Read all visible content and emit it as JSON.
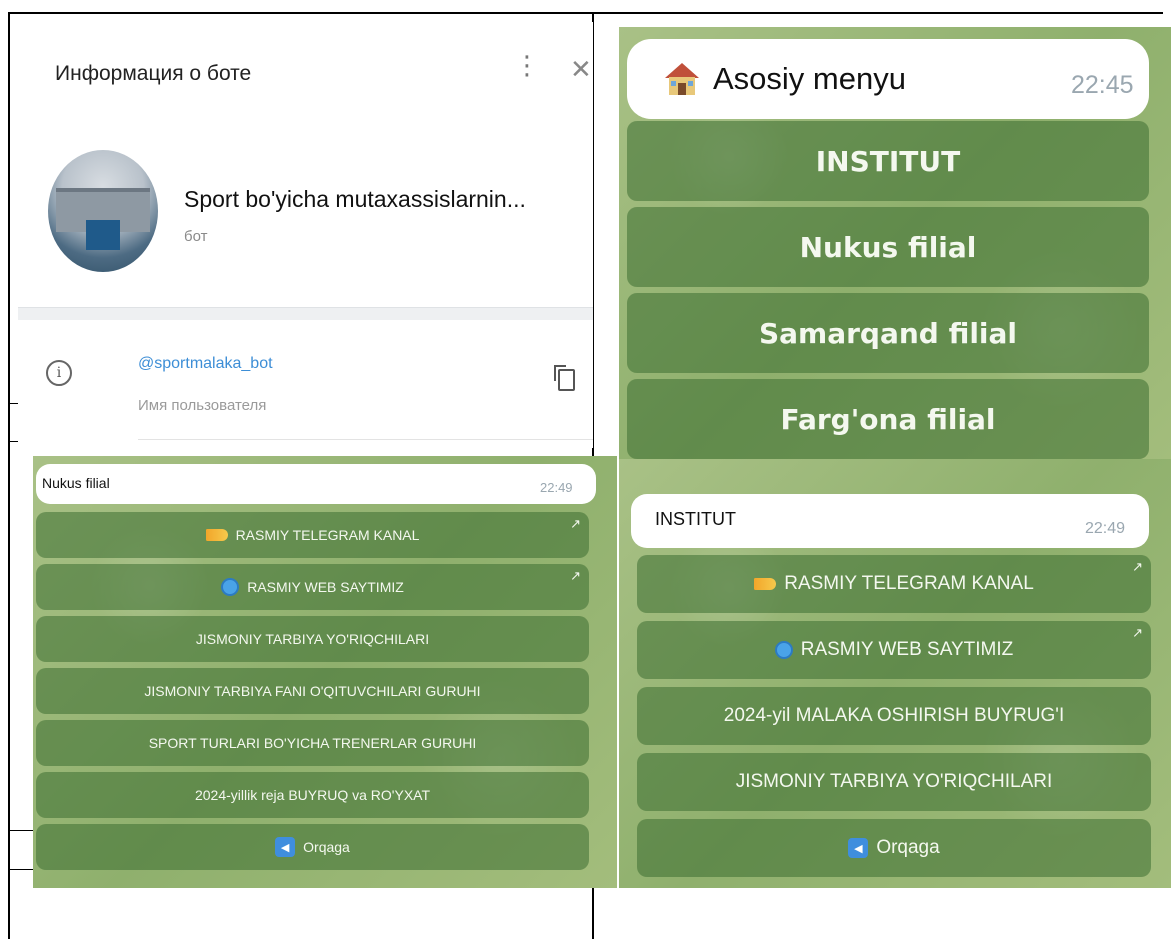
{
  "info_panel": {
    "title": "Информация о боте",
    "bot_name": "Sport bo'yicha mutaxassislarnin...",
    "bot_type": "бот",
    "username": "@sportmalaka_bot",
    "username_label": "Имя пользователя",
    "icons": [
      "more-vertical-icon",
      "close-icon",
      "info-icon",
      "copy-icon"
    ]
  },
  "main_menu": {
    "bubble_text": "Asosiy menyu",
    "time": "22:45",
    "buttons": [
      "INSTITUT",
      "Nukus filial",
      "Samarqand filial",
      "Farg'ona filial"
    ]
  },
  "nukus_chat": {
    "bubble_text": "Nukus filial",
    "time": "22:49",
    "buttons": [
      "RASMIY TELEGRAM KANAL",
      "RASMIY WEB SAYTIMIZ",
      "JISMONIY TARBIYA YO'RIQCHILARI",
      "JISMONIY TARBIYA FANI O'QITUVCHILARI GURUHI",
      "SPORT TURLARI BO'YICHA TRENERLAR GURUHI",
      "2024-yillik reja BUYRUQ va RO'YXAT",
      "Orqaga"
    ]
  },
  "institut_chat": {
    "bubble_text": "INSTITUT",
    "time": "22:49",
    "buttons": [
      "RASMIY TELEGRAM KANAL",
      "RASMIY WEB SAYTIMIZ",
      "2024-yil MALAKA OSHIRISH BUYRUG'I",
      "JISMONIY TARBIYA YO'RIQCHILARI",
      "Orqaga"
    ]
  },
  "colors": {
    "chat_bg": "#9bb877",
    "button_bg": "#5d8a4a",
    "link": "#3d8ed6"
  }
}
